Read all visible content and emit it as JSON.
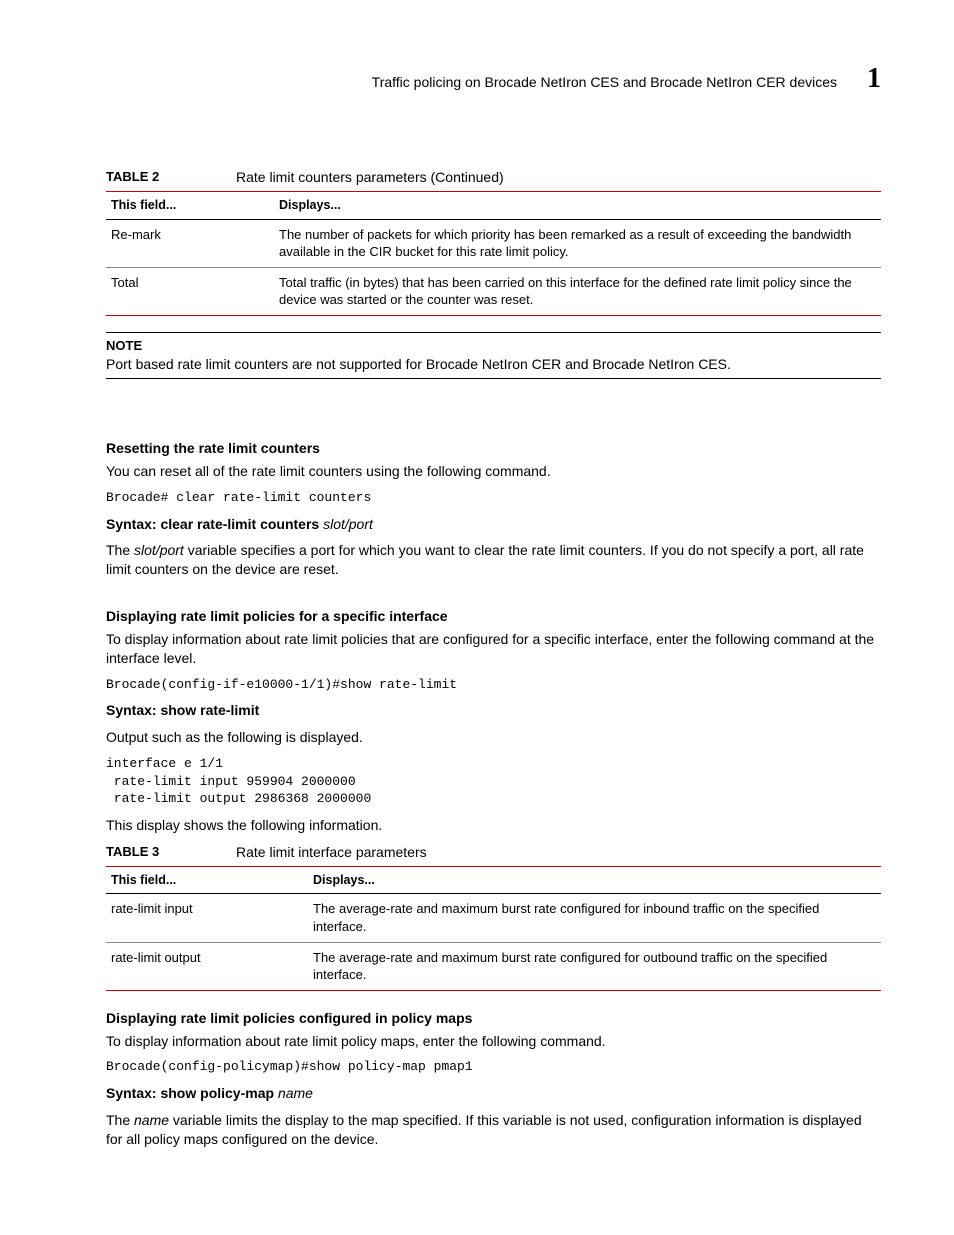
{
  "header": {
    "title": "Traffic policing on Brocade NetIron CES and  Brocade NetIron CER devices",
    "chapter": "1"
  },
  "table2": {
    "label": "TABLE 2",
    "caption": "Rate limit counters parameters  (Continued)",
    "col1": "This field...",
    "col2": "Displays...",
    "rows": [
      {
        "f": "Re-mark",
        "d": "The number of packets for which priority has been remarked as a result of exceeding the bandwidth available in the CIR bucket for this rate limit policy."
      },
      {
        "f": "Total",
        "d": "Total traffic (in bytes) that has been carried on this interface for the defined rate limit policy since the device was started or the counter was reset."
      }
    ]
  },
  "note": {
    "label": "NOTE",
    "text": "Port based rate limit counters are not supported for Brocade NetIron CER and Brocade NetIron CES."
  },
  "reset": {
    "heading": "Resetting the rate limit counters",
    "intro": "You can reset all of the rate limit counters using the following command.",
    "code": "Brocade# clear rate-limit counters",
    "syntax_prefix": "Syntax:  ",
    "syntax_bold": "clear rate-limit counters ",
    "syntax_ital": "slot/port",
    "desc_pre": "The ",
    "desc_ital": "slot/port",
    "desc_post": " variable specifies a port for which you want to clear the rate limit counters. If you do not specify a port, all rate limit counters on the device are reset."
  },
  "iface": {
    "heading": "Displaying rate limit policies for a specific interface",
    "intro": "To display information about rate limit policies that are configured for a specific interface, enter the following command at the interface level.",
    "code1": "Brocade(config-if-e10000-1/1)#show rate-limit",
    "syntax_prefix": "Syntax:  ",
    "syntax_bold": "show rate-limit",
    "out_intro": "Output such as the following is displayed.",
    "code2": "interface e 1/1\n rate-limit input 959904 2000000\n rate-limit output 2986368 2000000",
    "out_desc": "This display shows the following information."
  },
  "table3": {
    "label": "TABLE 3",
    "caption": "Rate limit interface parameters",
    "col1": "This field...",
    "col2": "Displays...",
    "rows": [
      {
        "f": "rate-limit input",
        "d": "The average-rate and maximum burst rate configured for inbound traffic on the specified interface."
      },
      {
        "f": "rate-limit output",
        "d": "The average-rate and maximum burst rate configured for outbound traffic on the specified interface."
      }
    ]
  },
  "pmap": {
    "heading": "Displaying rate limit policies configured in policy maps",
    "intro": "To display information about rate limit policy maps, enter the following command.",
    "code": "Brocade(config-policymap)#show policy-map pmap1",
    "syntax_prefix": "Syntax:  ",
    "syntax_bold": "show policy-map ",
    "syntax_ital": "name",
    "desc_pre": "The ",
    "desc_ital": "name",
    "desc_post": " variable limits the display to the map specified. If this variable is not used, configuration information is displayed for all policy maps configured on the device."
  }
}
